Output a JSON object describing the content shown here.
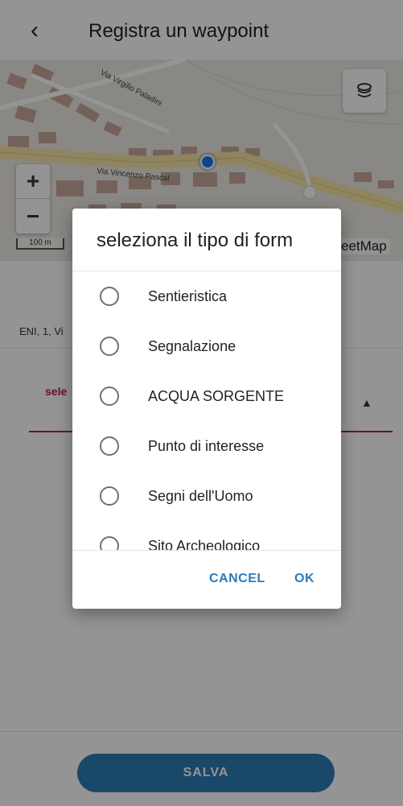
{
  "appbar": {
    "title": "Registra un waypoint",
    "back_icon": "chevron-left-icon"
  },
  "map": {
    "streets": [
      "Via Virgilio Paladini",
      "Via Vincenzo Pascal"
    ],
    "zoom_in": "+",
    "zoom_out": "−",
    "scale": "100 m",
    "attribution": "eetMap",
    "layers_icon": "layers-icon"
  },
  "form": {
    "address": "ENI, 1, Vi",
    "select_label": "sele",
    "select_arrow": "▲",
    "save_label": "SALVA"
  },
  "dialog": {
    "title": "seleziona il tipo di form",
    "options": [
      "Sentieristica",
      "Segnalazione",
      "ACQUA SORGENTE",
      "Punto di interesse",
      "Segni dell'Uomo",
      "Sito Archeologico"
    ],
    "cancel_label": "CANCEL",
    "ok_label": "OK"
  },
  "colors": {
    "accent": "#2a7bbf",
    "select_accent": "#c2185b",
    "save_button": "#2e7db6"
  }
}
